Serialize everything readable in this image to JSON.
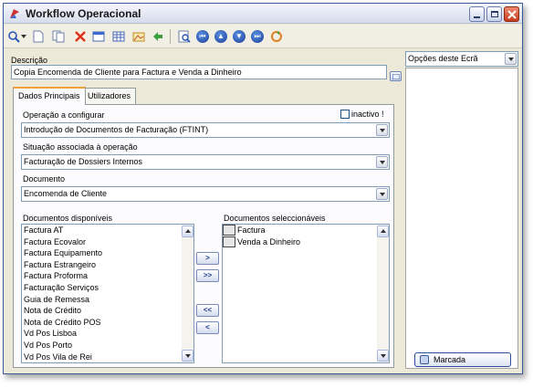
{
  "window": {
    "title": "Workflow Operacional"
  },
  "toolbar": {
    "icons": [
      "search-icon",
      "new-document-icon",
      "copy-icon",
      "delete-icon",
      "properties-icon",
      "grid-icon",
      "image-icon",
      "refresh-icon",
      "preview-icon",
      "first-record-icon",
      "previous-record-icon",
      "next-record-icon",
      "last-record-icon",
      "sync-icon"
    ]
  },
  "form": {
    "descricao_label": "Descrição",
    "descricao_value": "Copia Encomenda de Cliente para Factura e Venda a Dinheiro",
    "tabs": [
      {
        "label": "Dados Principais",
        "active": true
      },
      {
        "label": "Utilizadores",
        "active": false
      }
    ],
    "operacao_label": "Operação a configurar",
    "inactivo_label": "inactivo !",
    "inactivo_checked": false,
    "operacao_value": "Introdução de Documentos de Facturação (FTINT)",
    "situacao_label": "Situação associada à operação",
    "situacao_value": "Facturação de Dossiers Internos",
    "documento_label": "Documento",
    "documento_value": "Encomenda de Cliente",
    "disponiveis_label": "Documentos disponíveis",
    "disponiveis": [
      "Factura AT",
      "Factura Ecovalor",
      "Factura Equipamento",
      "Factura Estrangeiro",
      "Factura Proforma",
      "Facturação Serviços",
      "Guia de Remessa",
      "Nota de Crédito",
      "Nota de Crédito POS",
      "Vd Pos Lisboa",
      "Vd Pos Porto",
      "Vd Pos Vila de Rei"
    ],
    "seleccionaveis_label": "Documentos seleccionáveis",
    "seleccionaveis": [
      "Factura",
      "Venda a Dinheiro"
    ],
    "move_buttons": [
      ">",
      ">>",
      "<<",
      "<"
    ]
  },
  "side": {
    "opcoes_label": "Opções deste Ecrã",
    "marcada_label": "Marcada"
  },
  "colors": {
    "accent": "#f0a23a",
    "border": "#7f9db9",
    "window_bg": "#ece9d8"
  }
}
